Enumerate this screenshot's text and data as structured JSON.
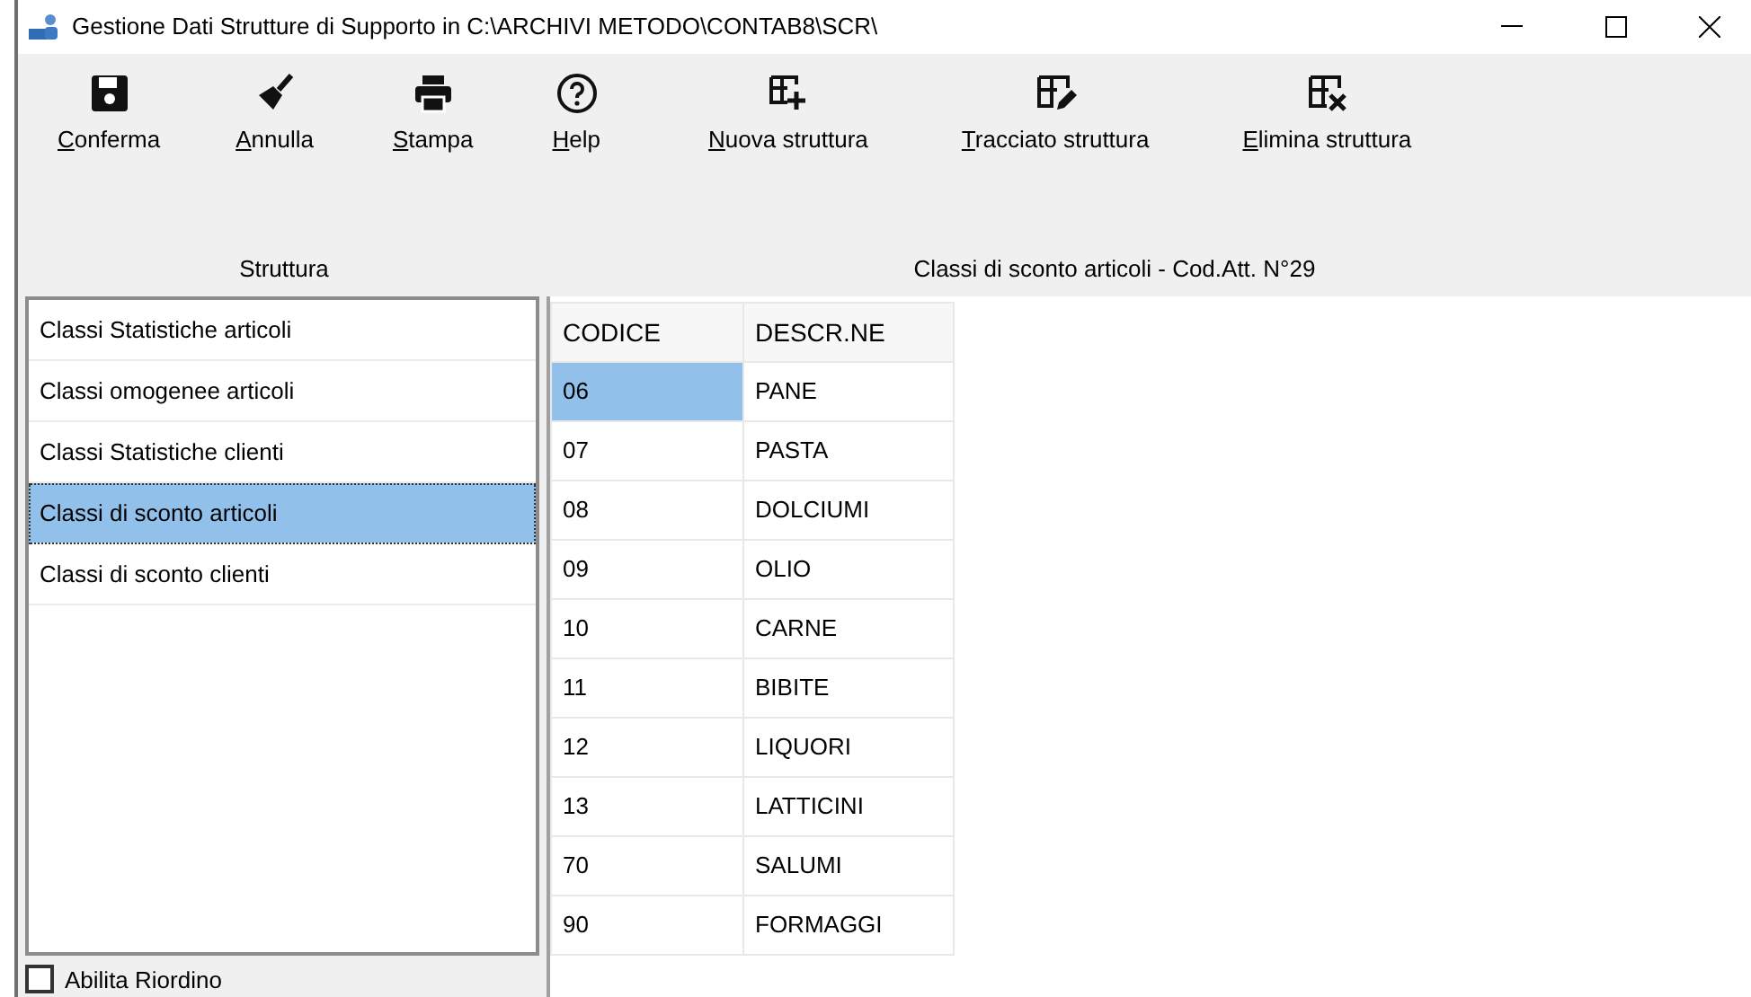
{
  "window": {
    "title": "Gestione Dati Strutture di Supporto in C:\\ARCHIVI METODO\\CONTAB8\\SCR\\"
  },
  "toolbar": [
    {
      "kind": "save",
      "accel": "C",
      "rest": "onferma"
    },
    {
      "kind": "broom",
      "accel": "A",
      "rest": "nnulla"
    },
    {
      "kind": "print",
      "accel": "S",
      "rest": "tampa"
    },
    {
      "kind": "help",
      "accel": "H",
      "rest": "elp"
    },
    {
      "kind": "add",
      "accel": "N",
      "rest": "uova struttura"
    },
    {
      "kind": "edit",
      "accel": "T",
      "rest": "racciato struttura"
    },
    {
      "kind": "delete",
      "accel": "E",
      "rest": "limina struttura"
    }
  ],
  "left_caption": "Struttura",
  "right_caption": "Classi di sconto articoli - Cod.Att. N°29",
  "structures": [
    {
      "label": "Classi Statistiche articoli",
      "selected": false
    },
    {
      "label": "Classi omogenee articoli",
      "selected": false
    },
    {
      "label": "Classi Statistiche clienti",
      "selected": false
    },
    {
      "label": "Classi di sconto articoli",
      "selected": true
    },
    {
      "label": "Classi di sconto clienti",
      "selected": false
    }
  ],
  "table": {
    "columns": [
      "CODICE",
      "DESCR.NE"
    ],
    "rows": [
      {
        "code": "06",
        "description": "PANE",
        "selected": true
      },
      {
        "code": "07",
        "description": "PASTA",
        "selected": false
      },
      {
        "code": "08",
        "description": "DOLCIUMI",
        "selected": false
      },
      {
        "code": "09",
        "description": "OLIO",
        "selected": false
      },
      {
        "code": "10",
        "description": "CARNE",
        "selected": false
      },
      {
        "code": "11",
        "description": "BIBITE",
        "selected": false
      },
      {
        "code": "12",
        "description": "LIQUORI",
        "selected": false
      },
      {
        "code": "13",
        "description": "LATTICINI",
        "selected": false
      },
      {
        "code": "70",
        "description": "SALUMI",
        "selected": false
      },
      {
        "code": "90",
        "description": "FORMAGGI",
        "selected": false
      }
    ]
  },
  "reorder_checkbox": {
    "label": "Abilita Riordino",
    "checked": false
  }
}
